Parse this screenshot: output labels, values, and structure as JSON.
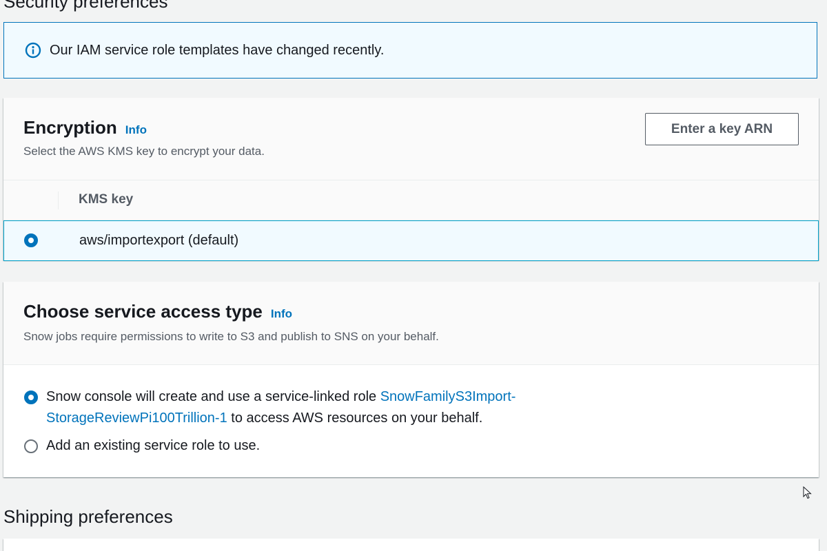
{
  "security": {
    "heading": "Security preferences"
  },
  "alert": {
    "icon": "info-circle-icon",
    "text": "Our IAM service role templates have changed recently."
  },
  "encryption": {
    "title": "Encryption",
    "info_label": "Info",
    "description": "Select the AWS KMS key to encrypt your data.",
    "enter_key_button": "Enter a key ARN",
    "table": {
      "column_header": "KMS key",
      "rows": [
        {
          "label": "aws/importexport (default)",
          "selected": true
        }
      ]
    }
  },
  "service_access": {
    "title": "Choose service access type",
    "info_label": "Info",
    "description": "Snow jobs require permissions to write to S3 and publish to SNS on your behalf.",
    "options": [
      {
        "prefix": "Snow console will create and use a service-linked role ",
        "link_line1": "SnowFamilyS3Import-",
        "link_line2": "StorageReviewPi100Trillion-1",
        "suffix": " to access AWS resources on your behalf.",
        "selected": true
      },
      {
        "label": "Add an existing service role to use.",
        "selected": false
      }
    ]
  },
  "shipping": {
    "heading": "Shipping preferences"
  },
  "colors": {
    "accent": "#0073bb",
    "alert_bg": "#f1faff",
    "page_bg": "#f2f3f3"
  }
}
